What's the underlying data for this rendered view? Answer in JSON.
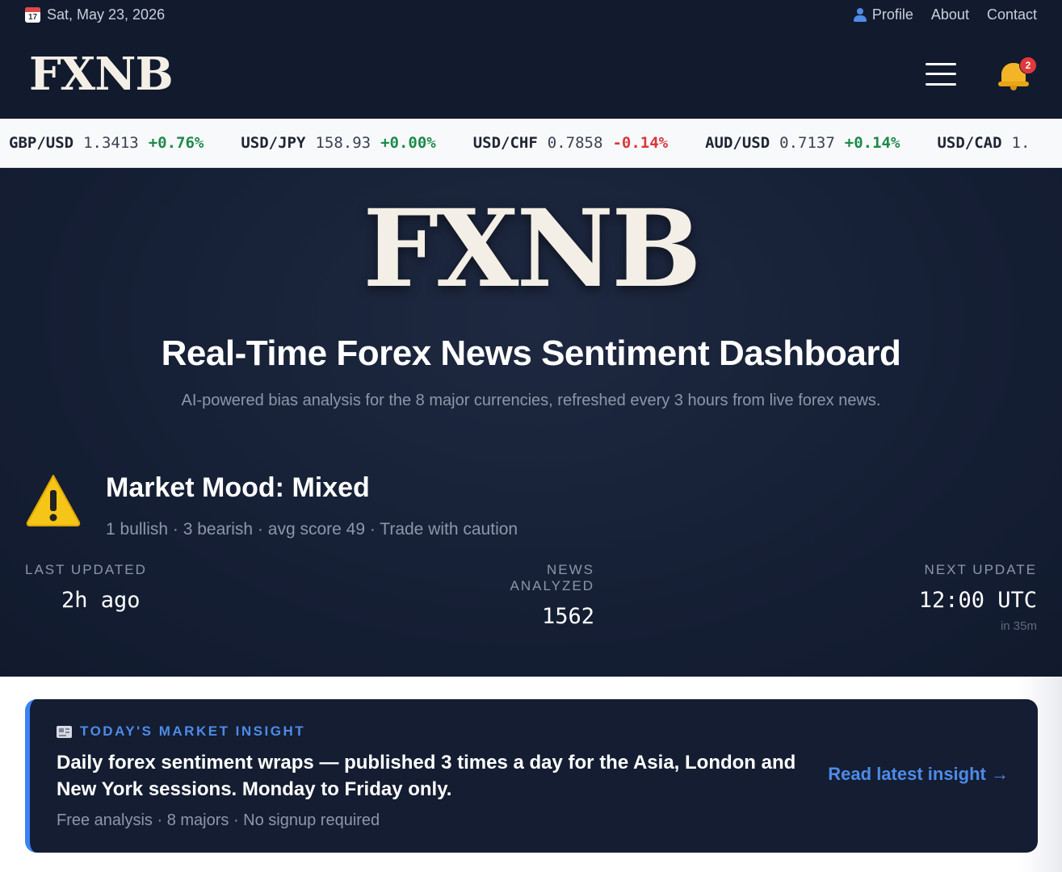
{
  "topbar": {
    "calendar_day": "17",
    "date": "Sat, May 23, 2026",
    "links": {
      "profile": "Profile",
      "about": "About",
      "contact": "Contact"
    }
  },
  "header": {
    "logo": "FXNB",
    "notification_count": "2"
  },
  "ticker": [
    {
      "pair": "GBP/USD",
      "price": "1.3413",
      "change": "+0.76%",
      "direction": "up"
    },
    {
      "pair": "USD/JPY",
      "price": "158.93",
      "change": "+0.00%",
      "direction": "up"
    },
    {
      "pair": "USD/CHF",
      "price": "0.7858",
      "change": "-0.14%",
      "direction": "down"
    },
    {
      "pair": "AUD/USD",
      "price": "0.7137",
      "change": "+0.14%",
      "direction": "up"
    },
    {
      "pair": "USD/CAD",
      "price": "1.",
      "change": "",
      "direction": ""
    }
  ],
  "hero": {
    "logo": "FXNB",
    "title": "Real-Time Forex News Sentiment Dashboard",
    "subtitle": "AI-powered bias analysis for the 8 major currencies, refreshed every 3 hours from live forex news."
  },
  "mood": {
    "icon": "warning-icon",
    "title": "Market Mood: Mixed",
    "detail": "1 bullish · 3 bearish · avg score 49 · Trade with caution"
  },
  "stats": {
    "last_updated": {
      "label": "LAST UPDATED",
      "value": "2h ago"
    },
    "news_analyzed": {
      "label": "NEWS ANALYZED",
      "value": "1562"
    },
    "next_update": {
      "label": "NEXT UPDATE",
      "value": "12:00 UTC",
      "note": "in 35m"
    }
  },
  "insight": {
    "tag": "TODAY'S MARKET INSIGHT",
    "headline": "Daily forex sentiment wraps — published 3 times a day for the Asia, London and New York sessions. Monday to Friday only.",
    "meta": "Free analysis · 8 majors · No signup required",
    "link": "Read latest insight →"
  },
  "colors": {
    "navy": "#121a2e",
    "accent_blue": "#4d8be8",
    "positive": "#1c8a4a",
    "negative": "#d8383a"
  }
}
